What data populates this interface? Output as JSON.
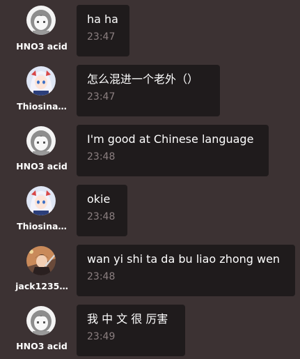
{
  "messages": [
    {
      "name": "HNO3 acid",
      "avatar": "gray-hair-girl-avatar-icon",
      "text": "ha ha",
      "time": "23:47"
    },
    {
      "name": "Thiosina…",
      "avatar": "white-hair-girl-avatar-icon",
      "text": "怎么混进一个老外（）",
      "time": "23:47"
    },
    {
      "name": "HNO3 acid",
      "avatar": "gray-hair-girl-avatar-icon",
      "text": "I'm good at Chinese language",
      "time": "23:48"
    },
    {
      "name": "Thiosina…",
      "avatar": "white-hair-girl-avatar-icon",
      "text": "okie",
      "time": "23:48"
    },
    {
      "name": "jack1235…",
      "avatar": "anime-warrior-avatar-icon",
      "text": "wan yi shi ta da bu liao zhong wen",
      "time": "23:48"
    },
    {
      "name": "HNO3 acid",
      "avatar": "gray-hair-girl-avatar-icon",
      "text": "我 中 文 很 厉害",
      "time": "23:49"
    }
  ],
  "colors": {
    "background": "#3c3233",
    "bubble": "#1f1b1c",
    "timestamp": "#8b7f80",
    "text": "#ffffff"
  }
}
